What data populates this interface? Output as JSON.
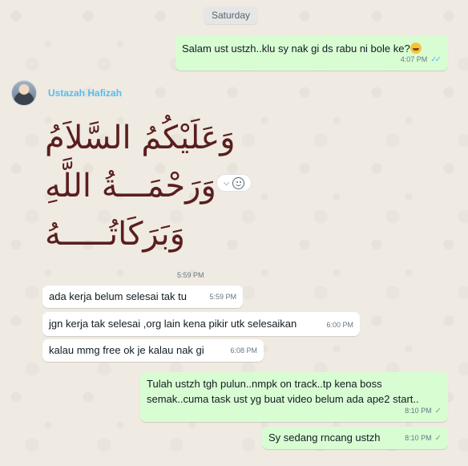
{
  "date_separator": "Saturday",
  "contact": {
    "name": "Ustazah Hafizah"
  },
  "messages": [
    {
      "direction": "out",
      "text": "Salam ust ustzh..klu sy nak gi ds rabu ni bole ke?",
      "emoji": "grinning-sweat-emoji",
      "time": "4:07 PM",
      "status": "read"
    },
    {
      "direction": "in",
      "type": "sticker",
      "lines": [
        "وَعَلَيْكُمُ السَّلاَمُ",
        "وَرَحْمَـــةُ اللَّهِ",
        "وَبَرَكَاتُـــــهُ"
      ],
      "time": "5:59 PM"
    },
    {
      "direction": "in",
      "text": "ada kerja belum selesai tak tu",
      "time": "5:59 PM"
    },
    {
      "direction": "in",
      "text": "jgn kerja tak selesai ,org lain kena pikir utk selesaikan",
      "time": "6:00 PM"
    },
    {
      "direction": "in",
      "text": "kalau mmg free ok je kalau nak gi",
      "time": "6:08 PM"
    },
    {
      "direction": "out",
      "text_lines": [
        "Tulah ustzh tgh pulun..nmpk on track..tp kena boss",
        "semak..cuma task ust yg buat video belum ada ape2 start.."
      ],
      "time": "8:10 PM",
      "status": "sent"
    },
    {
      "direction": "out",
      "text": "Sy sedang rncang ustzh",
      "time": "8:10 PM",
      "status": "sent"
    }
  ],
  "colors": {
    "outgoing": "#d9fdd3",
    "incoming": "#ffffff",
    "read_tick": "#53bdeb",
    "sender_name": "#53bdeb",
    "background": "#efeae2"
  }
}
